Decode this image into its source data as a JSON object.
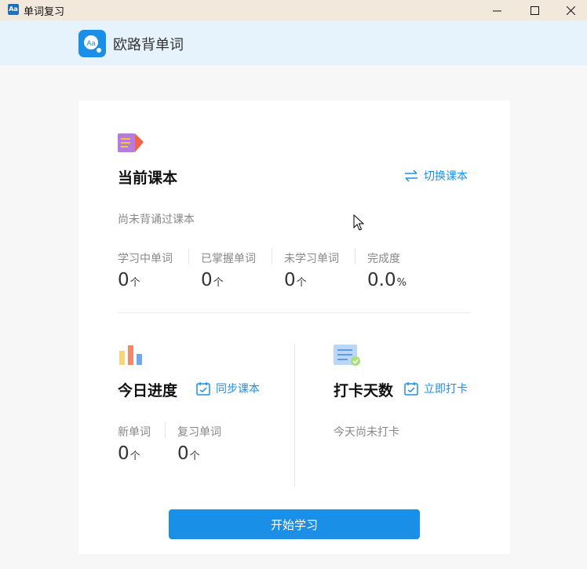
{
  "window": {
    "title": "单词复习",
    "icon_text": "Aa"
  },
  "app": {
    "name": "欧路背单词"
  },
  "colors": {
    "accent": "#1a8fe8",
    "header_bg": "#e6f3fd",
    "titlebar_bg": "#f2e9dc"
  },
  "current_book": {
    "title": "当前课本",
    "switch_label": "切换课本",
    "status": "尚未背诵过课本",
    "stats": [
      {
        "label": "学习中单词",
        "value": "0",
        "unit": "个"
      },
      {
        "label": "已掌握单词",
        "value": "0",
        "unit": "个"
      },
      {
        "label": "未学习单词",
        "value": "0",
        "unit": "个"
      },
      {
        "label": "完成度",
        "value": "0.0",
        "unit": "%"
      }
    ]
  },
  "today_progress": {
    "title": "今日进度",
    "sync_label": "同步课本",
    "stats": [
      {
        "label": "新单词",
        "value": "0",
        "unit": "个"
      },
      {
        "label": "复习单词",
        "value": "0",
        "unit": "个"
      }
    ]
  },
  "checkin": {
    "title": "打卡天数",
    "checkin_label": "立即打卡",
    "status": "今天尚未打卡"
  },
  "start_button": "开始学习"
}
